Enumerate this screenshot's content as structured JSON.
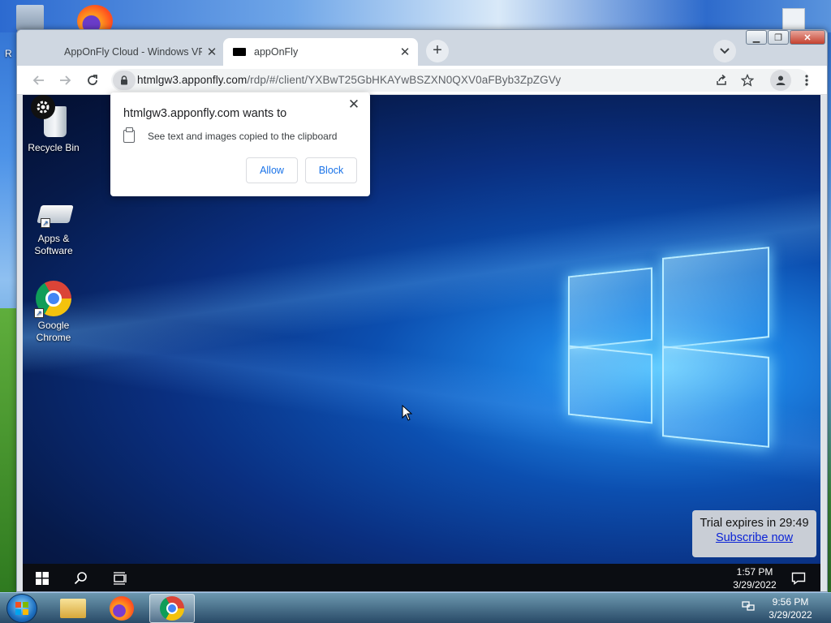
{
  "browser": {
    "tabs": [
      {
        "title": "AppOnFly Cloud - Windows VPS",
        "active": false
      },
      {
        "title": "appOnFly",
        "active": true
      }
    ],
    "url_host": "htmlgw3.apponfly.com",
    "url_path": "/rdp/#/client/YXBwT25GbHKAYwBSZXN0QXV0aFByb3ZpZGVy"
  },
  "permission_popup": {
    "title": "htmlgw3.apponfly.com wants to",
    "request": "See text and images copied to the clipboard",
    "allow_label": "Allow",
    "block_label": "Block"
  },
  "remote_desktop": {
    "icons": [
      {
        "label": "Recycle Bin"
      },
      {
        "label": "Apps & Software"
      },
      {
        "label": "Google Chrome"
      }
    ],
    "trial": {
      "text": "Trial expires in 29:49",
      "link": "Subscribe now"
    },
    "clock_time": "1:57 PM",
    "clock_date": "3/29/2022"
  },
  "outer_desktop": {
    "partial_label": "R",
    "clock_time": "9:56 PM",
    "clock_date": "3/29/2022"
  }
}
